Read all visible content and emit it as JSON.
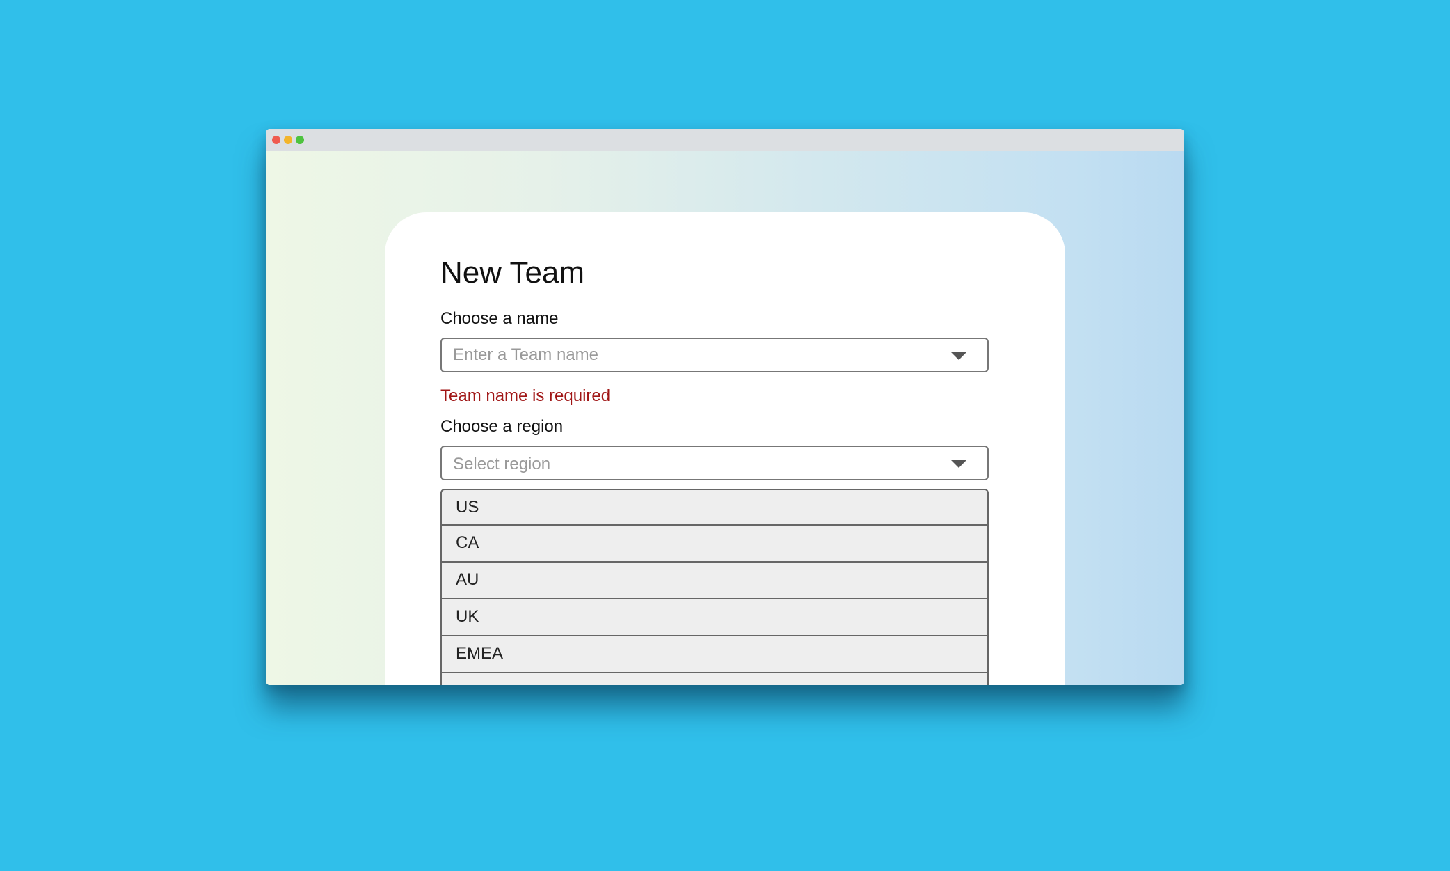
{
  "form": {
    "title": "New Team",
    "name_label": "Choose a name",
    "name_placeholder": "Enter a Team name",
    "name_error": "Team name is required",
    "region_label": "Choose a region",
    "region_placeholder": "Select region",
    "region_options": [
      "US",
      "CA",
      "AU",
      "UK",
      "EMEA",
      ""
    ]
  },
  "icons": {
    "window_controls": [
      "close-icon",
      "minimize-icon",
      "maximize-icon"
    ],
    "dropdown_caret": "chevron-down-icon"
  },
  "colors": {
    "background": "#30bfea",
    "error": "#a01616",
    "window_close": "#ef5b4f",
    "window_minimize": "#f3b52b",
    "window_maximize": "#4ec33f"
  }
}
